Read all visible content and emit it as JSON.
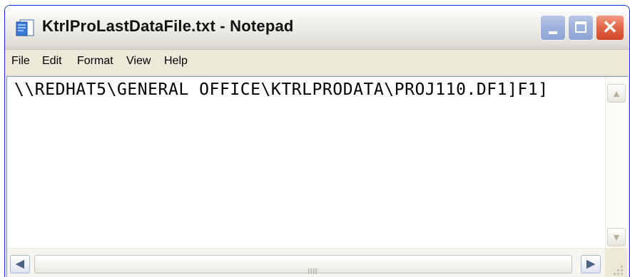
{
  "window": {
    "title": "KtrlProLastDataFile.txt - Notepad",
    "app_icon": "notepad-icon"
  },
  "titlebar_buttons": {
    "minimize_icon": "minimize-icon",
    "maximize_icon": "maximize-icon",
    "close_icon": "close-icon",
    "close_glyph": "✕"
  },
  "menu": {
    "items": [
      {
        "label": "File"
      },
      {
        "label": "Edit"
      },
      {
        "label": "Format"
      },
      {
        "label": "View"
      },
      {
        "label": "Help"
      }
    ]
  },
  "editor": {
    "content": "\\\\REDHAT5\\GENERAL OFFICE\\KTRLPRODATA\\PROJ110.DF1]F1]"
  },
  "scrollbars": {
    "up_arrow": "▲",
    "down_arrow": "▼",
    "left_arrow": "◀",
    "right_arrow": "▶",
    "thumb_grip": "grip-icon"
  },
  "colors": {
    "titlebar_close": "#d2462a",
    "titlebar_buttons": "#9fb3de",
    "window_border": "#0831d9",
    "chrome": "#ece9d8"
  }
}
